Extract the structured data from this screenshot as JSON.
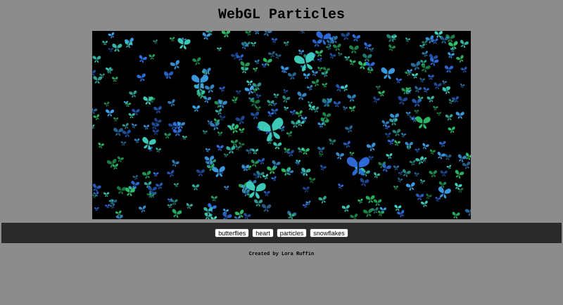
{
  "page": {
    "title": "WebGL Particles",
    "credit": "Created by Lora Ruffin"
  },
  "canvas": {
    "scene": "butterflies",
    "background_color": "#000000",
    "particle_colors": [
      "#2f6fe0",
      "#3fa0e8",
      "#2fc06a",
      "#41d3c0"
    ]
  },
  "toolbar": {
    "buttons": [
      {
        "label": "butterflies",
        "icon": ""
      },
      {
        "label": "heart",
        "icon": ""
      },
      {
        "label": "particles",
        "icon": ""
      },
      {
        "label": "snowflakes",
        "icon": ""
      }
    ]
  }
}
